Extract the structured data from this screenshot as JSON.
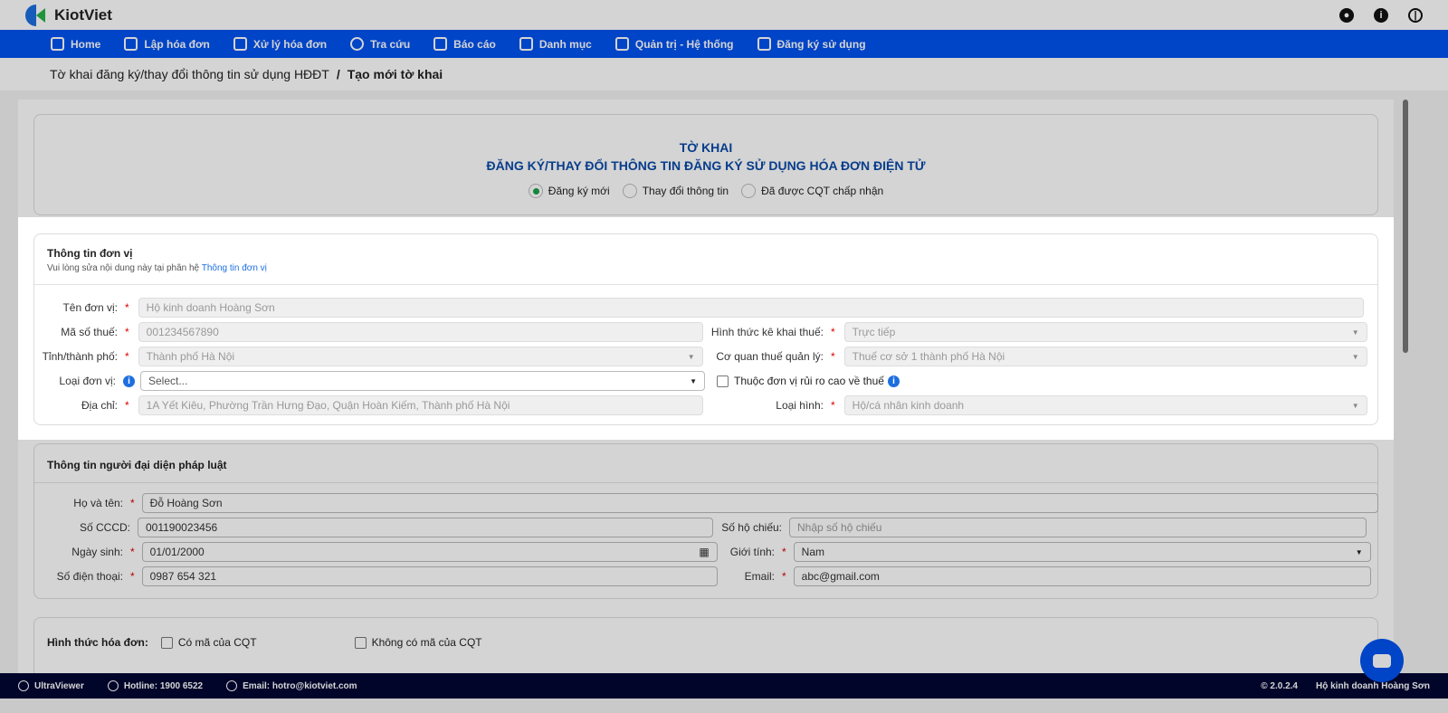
{
  "app": {
    "name": "KiotViet"
  },
  "nav": [
    {
      "label": "Home"
    },
    {
      "label": "Lập hóa đơn"
    },
    {
      "label": "Xử lý hóa đơn"
    },
    {
      "label": "Tra cứu"
    },
    {
      "label": "Báo cáo"
    },
    {
      "label": "Danh mục"
    },
    {
      "label": "Quản trị - Hệ thống"
    },
    {
      "label": "Đăng ký sử dụng"
    }
  ],
  "breadcrumb": {
    "parent": "Tờ khai đăng ký/thay đổi thông tin sử dụng HĐĐT",
    "sep": "/",
    "current": "Tạo mới tờ khai"
  },
  "form": {
    "title1": "TỜ KHAI",
    "title2": "ĐĂNG KÝ/THAY ĐỔI THÔNG TIN ĐĂNG KÝ SỬ DỤNG HÓA ĐƠN ĐIỆN TỬ",
    "radios": [
      {
        "label": "Đăng ký mới",
        "checked": true
      },
      {
        "label": "Thay đổi thông tin"
      },
      {
        "label": "Đã được CQT chấp nhận"
      }
    ]
  },
  "unit": {
    "title": "Thông tin đơn vị",
    "sub": "Vui lòng sửa nội dung này tại phân hệ",
    "sub_link": "Thông tin đơn vị",
    "ten_lbl": "Tên đơn vị:",
    "ten": "Hộ kinh doanh Hoàng Sơn",
    "mst_lbl": "Mã số thuế:",
    "mst": "001234567890",
    "tinh_lbl": "Tỉnh/thành phố:",
    "tinh": "Thành phố Hà Nội",
    "loai_lbl": "Loại đơn vị:",
    "loai_ph": "Select...",
    "dc_lbl": "Địa chỉ:",
    "dc": "1A Yết Kiêu, Phường Trần Hưng Đạo, Quận Hoàn Kiếm, Thành phố Hà Nội",
    "htk_lbl": "Hình thức kê khai thuế:",
    "htk": "Trực tiếp",
    "cq_lbl": "Cơ quan thuế quản lý:",
    "cq": "Thuế cơ sở 1 thành phố Hà Nội",
    "rr_lbl": "Thuộc đơn vị rủi ro cao về thuế",
    "lh_lbl": "Loại hình:",
    "lh": "Hộ/cá nhân kinh doanh"
  },
  "rep": {
    "title": "Thông tin người đại diện pháp luật",
    "ht_lbl": "Họ và tên:",
    "ht": "Đỗ Hoàng Sơn",
    "cccd_lbl": "Số CCCD:",
    "cccd": "001190023456",
    "hc_lbl": "Số hộ chiếu:",
    "hc_ph": "Nhập số hộ chiếu",
    "ns_lbl": "Ngày sinh:",
    "ns": "01/01/2000",
    "gt_lbl": "Giới tính:",
    "gt": "Nam",
    "dt_lbl": "Số điện thoại:",
    "dt": "0987 654 321",
    "em_lbl": "Email:",
    "em": "abc@gmail.com"
  },
  "invoice": {
    "lbl": "Hình thức hóa đơn:",
    "opt1": "Có mã của CQT",
    "opt2": "Không có mã của CQT"
  },
  "footer": {
    "ultra": "UltraViewer",
    "hotline": "Hotline: 1900 6522",
    "email": "Email: hotro@kiotviet.com",
    "version": "© 2.0.2.4",
    "company": "Hộ kinh doanh Hoàng Sơn"
  },
  "colors": {
    "nav": "#0052f0",
    "title": "#0a4aa8",
    "footer": "#020733"
  }
}
